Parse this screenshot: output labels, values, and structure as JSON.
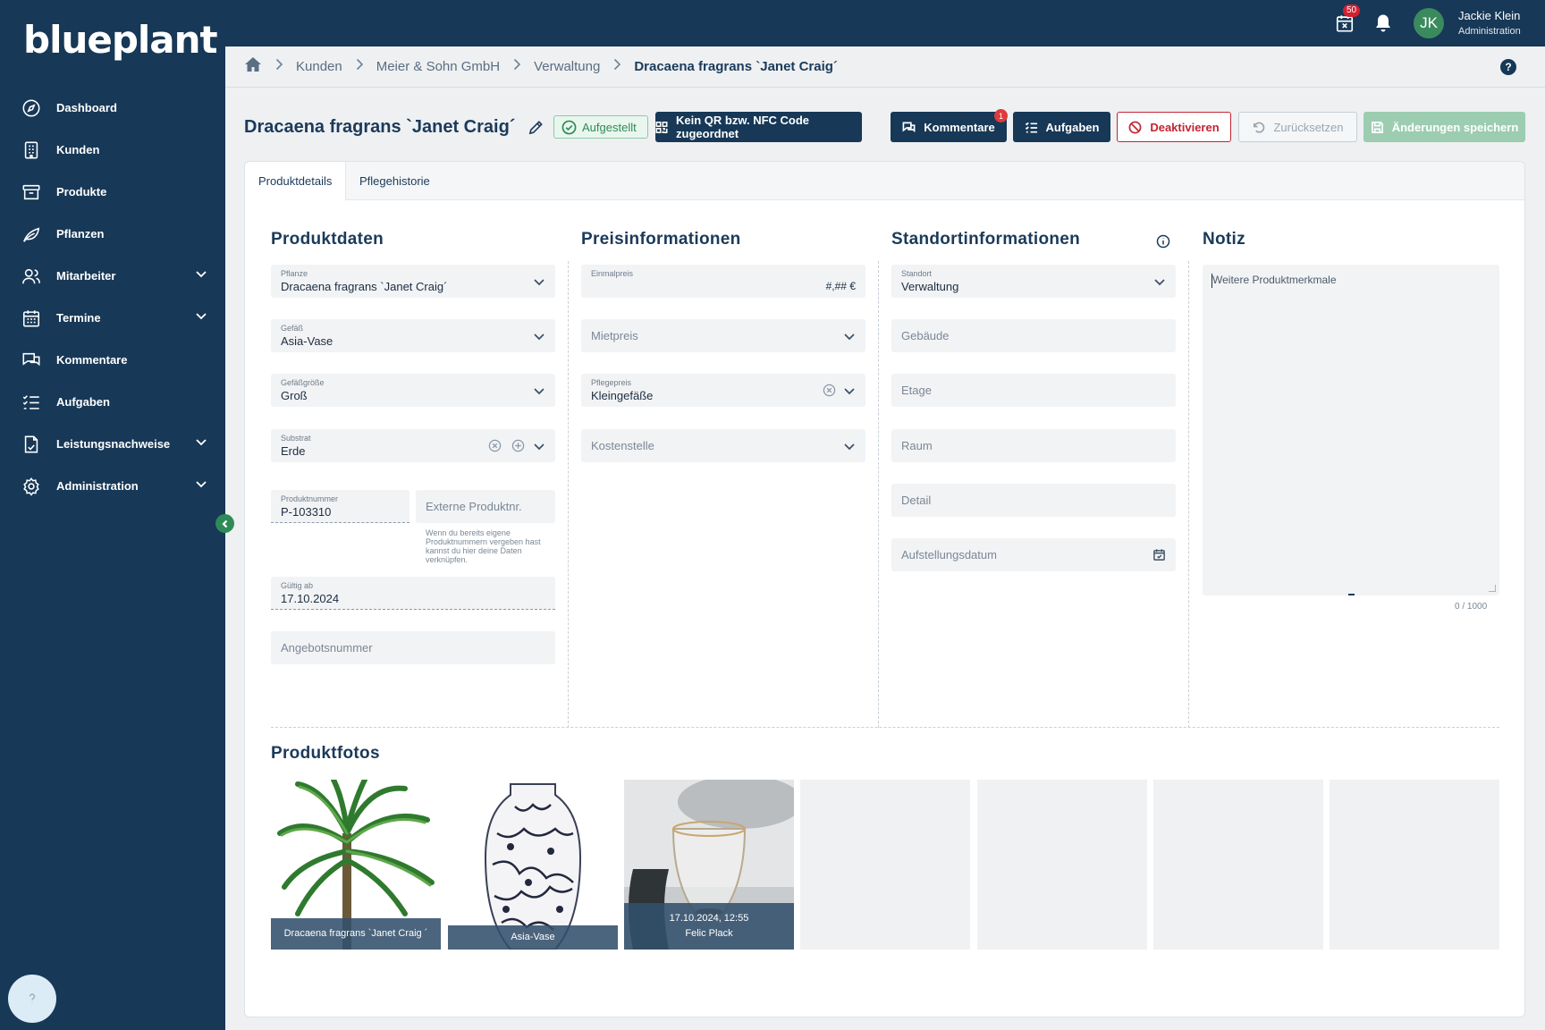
{
  "app": {
    "logo": "blueplant"
  },
  "sidebar": {
    "items": [
      {
        "label": "Dashboard",
        "icon": "compass-icon",
        "expandable": false
      },
      {
        "label": "Kunden",
        "icon": "building-icon",
        "expandable": false
      },
      {
        "label": "Produkte",
        "icon": "archive-icon",
        "expandable": false
      },
      {
        "label": "Pflanzen",
        "icon": "leaf-icon",
        "expandable": false
      },
      {
        "label": "Mitarbeiter",
        "icon": "users-icon",
        "expandable": true
      },
      {
        "label": "Termine",
        "icon": "calendar-icon",
        "expandable": true
      },
      {
        "label": "Kommentare",
        "icon": "chat-icon",
        "expandable": false
      },
      {
        "label": "Aufgaben",
        "icon": "checklist-icon",
        "expandable": false
      },
      {
        "label": "Leistungsnachweise",
        "icon": "document-icon",
        "expandable": true
      },
      {
        "label": "Administration",
        "icon": "gear-icon",
        "expandable": true
      }
    ]
  },
  "topbar": {
    "calendar_badge": "50",
    "avatar_initials": "JK",
    "user_name": "Jackie Klein",
    "user_role": "Administration"
  },
  "breadcrumb": [
    "Kunden",
    "Meier & Sohn GmbH",
    "Verwaltung",
    "Dracaena fragrans `Janet Craig´"
  ],
  "header": {
    "title": "Dracaena fragrans `Janet Craig´",
    "status": "Aufgestellt",
    "buttons": {
      "qr": "Kein QR bzw. NFC Code zugeordnet",
      "comments": "Kommentare",
      "comments_badge": "1",
      "tasks": "Aufgaben",
      "deactivate": "Deaktivieren",
      "reset": "Zurücksetzen",
      "save": "Änderungen speichern"
    }
  },
  "tabs": [
    "Produktdetails",
    "Pflegehistorie"
  ],
  "sections": {
    "produktdaten": "Produktdaten",
    "preis": "Preisinformationen",
    "standort": "Standortinformationen",
    "notiz": "Notiz",
    "fotos": "Produktfotos"
  },
  "produktdaten": {
    "pflanze": {
      "label": "Pflanze",
      "value": "Dracaena fragrans `Janet Craig´"
    },
    "gefaess": {
      "label": "Gefäß",
      "value": "Asia-Vase"
    },
    "gefaessgroesse": {
      "label": "Gefäßgröße",
      "value": "Groß"
    },
    "substrat": {
      "label": "Substrat",
      "value": "Erde"
    },
    "produktnummer": {
      "label": "Produktnummer",
      "value": "P-103310"
    },
    "externe_produktnr": {
      "placeholder": "Externe Produktnr."
    },
    "hint": "Wenn du bereits eigene Produktnummern vergeben hast kannst du hier deine Daten verknüpfen.",
    "gueltig_ab": {
      "label": "Gültig ab",
      "value": "17.10.2024"
    },
    "angebotsnummer": {
      "placeholder": "Angebotsnummer"
    }
  },
  "preis": {
    "einmalpreis": {
      "label": "Einmalpreis",
      "value": "#,## €"
    },
    "mietpreis": {
      "placeholder": "Mietpreis"
    },
    "pflegepreis": {
      "label": "Pflegepreis",
      "value": "Kleingefäße"
    },
    "kostenstelle": {
      "placeholder": "Kostenstelle"
    }
  },
  "standort": {
    "standort": {
      "label": "Standort",
      "value": "Verwaltung"
    },
    "gebaeude": {
      "placeholder": "Gebäude"
    },
    "etage": {
      "placeholder": "Etage"
    },
    "raum": {
      "placeholder": "Raum"
    },
    "detail": {
      "placeholder": "Detail"
    },
    "aufstellungsdatum": {
      "placeholder": "Aufstellungsdatum"
    }
  },
  "notiz": {
    "placeholder": "Weitere Produktmerkmale",
    "count": "0 / 1000"
  },
  "photos": [
    {
      "caption": "Dracaena fragrans `Janet Craig ´"
    },
    {
      "caption": "Asia-Vase"
    },
    {
      "caption_line1": "17.10.2024, 12:55",
      "caption_line2": "Felic Plack"
    }
  ],
  "colors": {
    "navy": "#173857",
    "success": "#2e8b57",
    "danger": "#c22433",
    "save_disabled": "#9ccdb1"
  }
}
